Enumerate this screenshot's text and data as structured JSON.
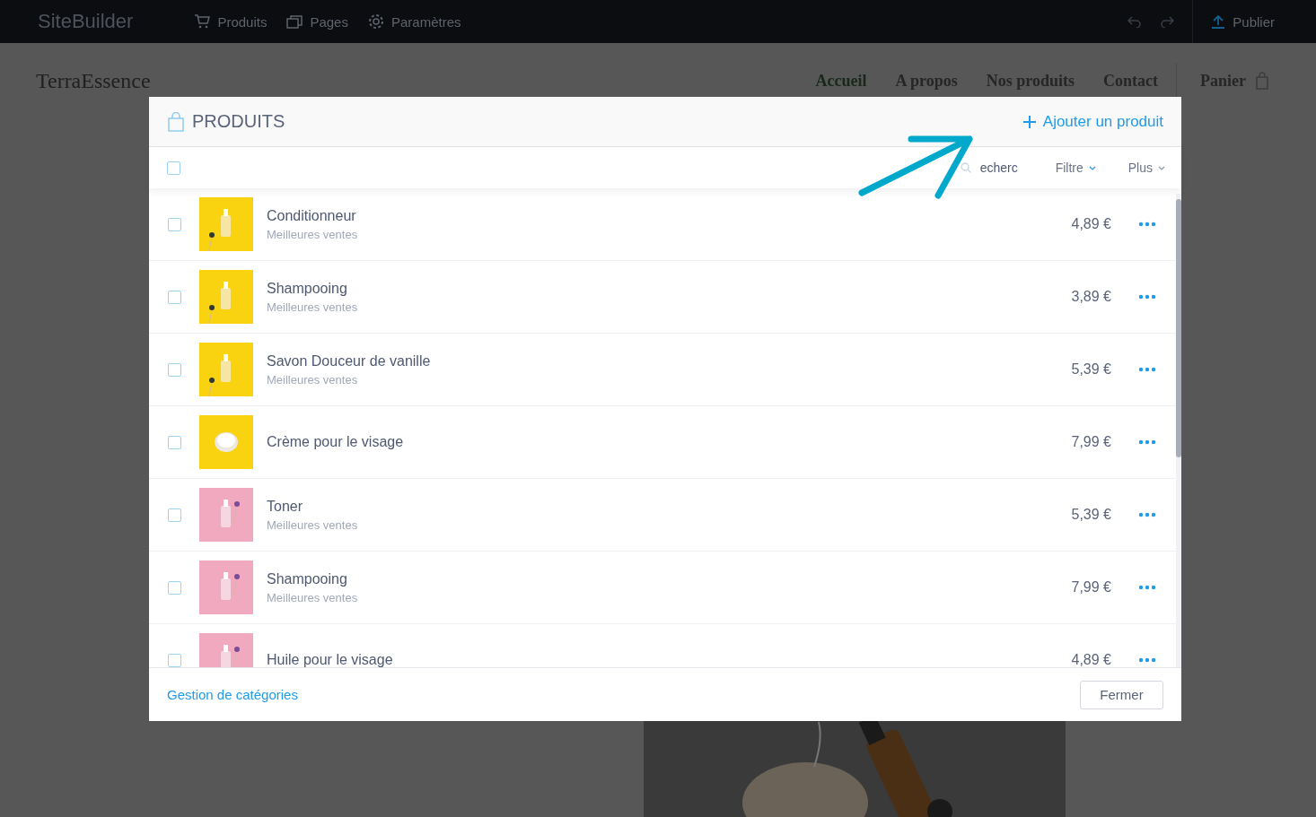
{
  "editor_bar": {
    "logo": "SiteBuilder",
    "menu": [
      {
        "label": "Produits"
      },
      {
        "label": "Pages"
      },
      {
        "label": "Paramètres"
      }
    ],
    "publish": "Publier"
  },
  "site": {
    "brand": "TerraEssence",
    "nav": [
      {
        "label": "Accueil",
        "selected": true
      },
      {
        "label": "A propos",
        "selected": false
      },
      {
        "label": "Nos produits",
        "selected": false
      },
      {
        "label": "Contact",
        "selected": false
      }
    ],
    "cart": "Panier"
  },
  "modal": {
    "title": "PRODUITS",
    "add_button": "Ajouter un produit",
    "toolbar": {
      "select_all": {
        "checked": false
      },
      "search": {
        "placeholder": "echerc"
      },
      "filter": "Filtre",
      "more": "Plus"
    },
    "products": [
      {
        "name": "Conditionneur",
        "category": "Meilleures ventes",
        "price": "4,89 €",
        "checked": false
      },
      {
        "name": "Shampooing",
        "category": "Meilleures ventes",
        "price": "3,89 €",
        "checked": false
      },
      {
        "name": "Savon Douceur de vanille",
        "category": "Meilleures ventes",
        "price": "5,39 €",
        "checked": false
      },
      {
        "name": "Crème pour le visage",
        "price": "7,99 €",
        "checked": false
      },
      {
        "name": "Toner",
        "category": "Meilleures ventes",
        "price": "5,39 €",
        "checked": false
      },
      {
        "name": "Shampooing",
        "category": "Meilleures ventes",
        "price": "7,99 €",
        "checked": false
      },
      {
        "name": "Huile pour le visage",
        "price": "4,89 €",
        "checked": false
      }
    ],
    "footer": {
      "link": "Gestion de catégories",
      "close": "Fermer"
    }
  }
}
